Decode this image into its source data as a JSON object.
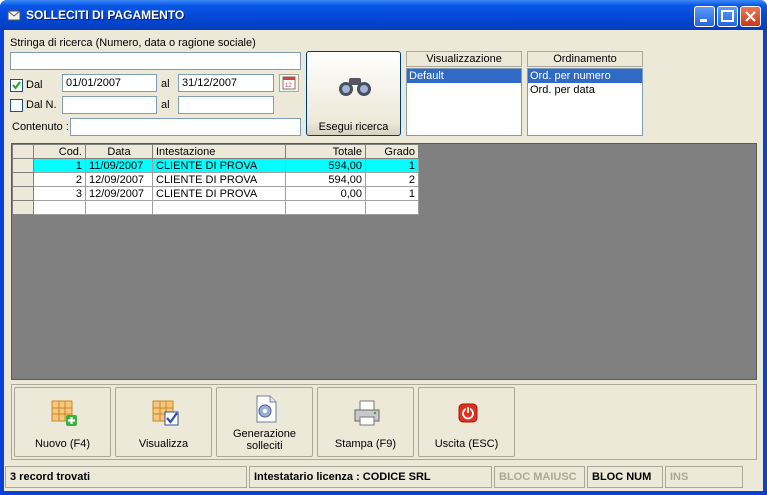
{
  "window": {
    "title": "SOLLECITI DI PAGAMENTO"
  },
  "search": {
    "label": "Stringa di ricerca (Numero, data o ragione sociale)",
    "value": "",
    "dal_label": "Dal",
    "dal_checked": true,
    "date_from": "01/01/2007",
    "al_label": "al",
    "date_to": "31/12/2007",
    "daln_label": "Dal N.",
    "daln_checked": false,
    "num_from": "",
    "al2_label": "al",
    "num_to": "",
    "contenuto_label": "Contenuto :",
    "contenuto_value": "",
    "search_button": "Esegui ricerca"
  },
  "visualizzazione": {
    "header": "Visualizzazione",
    "items": [
      "Default"
    ],
    "selected": 0
  },
  "ordinamento": {
    "header": "Ordinamento",
    "items": [
      "Ord. per numero",
      "Ord. per data"
    ],
    "selected": 0
  },
  "grid": {
    "headers": [
      "Cod.",
      "Data",
      "Intestazione",
      "Totale",
      "Grado"
    ],
    "rows": [
      [
        "1",
        "11/09/2007",
        "CLIENTE DI PROVA",
        "594,00",
        "1"
      ],
      [
        "2",
        "12/09/2007",
        "CLIENTE DI PROVA",
        "594,00",
        "2"
      ],
      [
        "3",
        "12/09/2007",
        "CLIENTE DI PROVA",
        "0,00",
        "1"
      ]
    ],
    "highlight_color": "#00ffff"
  },
  "actions": {
    "nuovo": "Nuovo (F4)",
    "visualizza": "Visualizza",
    "generazione": "Generazione solleciti",
    "stampa": "Stampa (F9)",
    "uscita": "Uscita (ESC)"
  },
  "status": {
    "records": "3 record trovati",
    "license": "Intestatario licenza : CODICE SRL",
    "caps": "BLOC MAIUSC",
    "num": "BLOC NUM",
    "ins": "INS"
  },
  "icons": {
    "app": "envelope-icon",
    "search": "binoculars-icon",
    "calendar": "calendar-icon",
    "nuovo": "grid-add-icon",
    "visualizza": "grid-check-icon",
    "generazione": "document-gear-icon",
    "stampa": "printer-icon",
    "uscita": "power-icon"
  }
}
